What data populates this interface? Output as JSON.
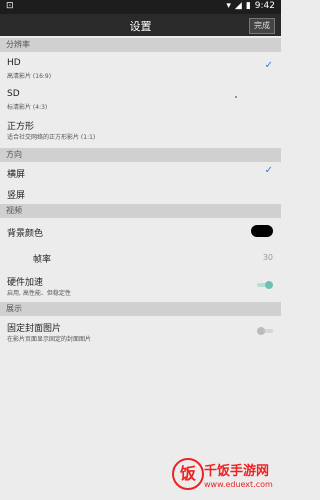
{
  "status": {
    "left": "⊡",
    "time": "9:42"
  },
  "header": {
    "title": "设置",
    "done_label": "完成"
  },
  "sections": {
    "resolution": {
      "title": "分辨率",
      "items": [
        {
          "label": "HD",
          "sub": "高清影片 (16:9)",
          "checked": true
        },
        {
          "label": "SD",
          "sub": "标清影片 (4:3)",
          "checked": false
        },
        {
          "label": "正方形",
          "sub": "适合社交网络的正方形影片 (1:1)",
          "checked": false
        }
      ]
    },
    "orientation": {
      "title": "方向",
      "items": [
        {
          "label": "横屏",
          "checked": true
        },
        {
          "label": "竖屏",
          "checked": false
        }
      ]
    },
    "video": {
      "title": "视频",
      "background_color": {
        "label": "背景颜色",
        "color": "#000000"
      },
      "frame_rate": {
        "label": "帧率",
        "value": "30"
      },
      "hw_accel": {
        "label": "硬件加速",
        "sub": "启用, 高性能、但稳定性",
        "enabled": true
      }
    },
    "display": {
      "title": "展示",
      "fixed_cover": {
        "label": "固定封面图片",
        "sub": "在影片页面显示固定的封面图片",
        "enabled": false
      }
    }
  },
  "watermark": {
    "name": "千饭手游网",
    "url": "www.eduext.com",
    "logo_char": "饭"
  },
  "colors": {
    "accent": "#3a7ad9",
    "toggle_on": "#6cc1b0",
    "toggle_off": "#bbbbbb",
    "brand": "#e22222"
  },
  "icons": {
    "check": "check-icon",
    "battery": "battery-icon",
    "signal": "signal-icon",
    "wifi": "wifi-icon"
  }
}
